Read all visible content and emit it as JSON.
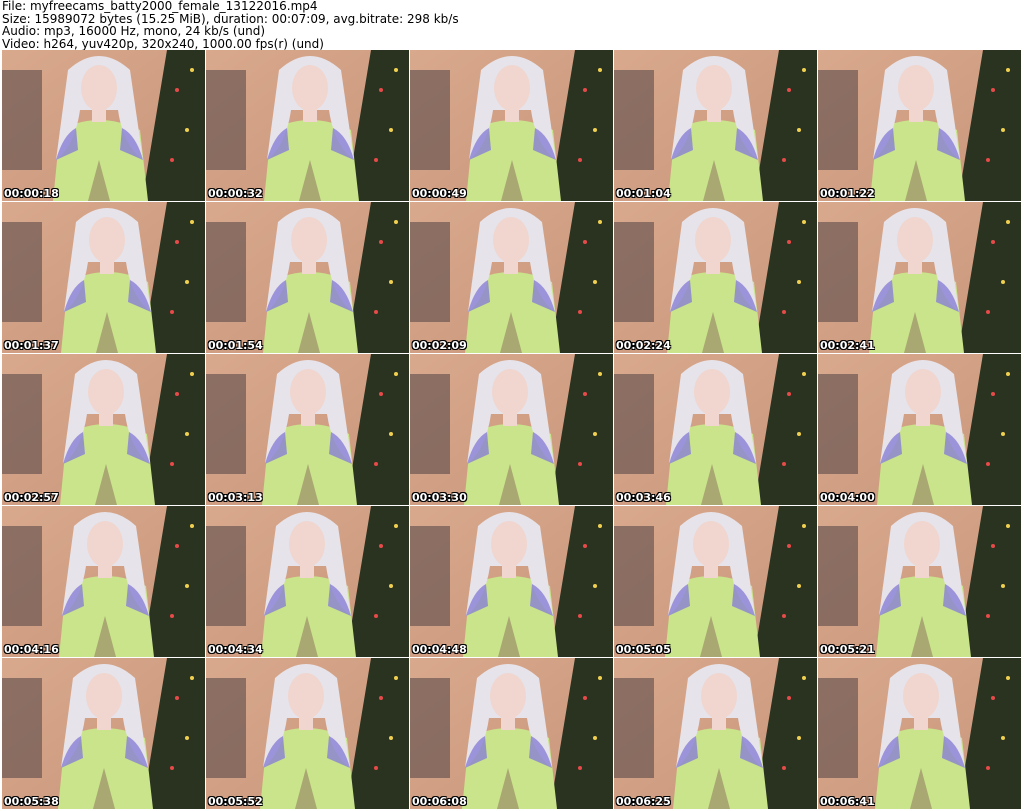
{
  "header": {
    "file_line": "File: myfreecams_batty2000_female_13122016.mp4",
    "size_line": "Size: 15989072 bytes (15.25 MiB), duration: 00:07:09, avg.bitrate: 298 kb/s",
    "audio_line": "Audio: mp3, 16000 Hz, mono, 24 kb/s (und)",
    "video_line": "Video: h264, yuv420p, 320x240, 1000.00 fps(r) (und)"
  },
  "thumbnails": [
    {
      "timestamp": "00:00:18"
    },
    {
      "timestamp": "00:00:32"
    },
    {
      "timestamp": "00:00:49"
    },
    {
      "timestamp": "00:01:04"
    },
    {
      "timestamp": "00:01:22"
    },
    {
      "timestamp": "00:01:37"
    },
    {
      "timestamp": "00:01:54"
    },
    {
      "timestamp": "00:02:09"
    },
    {
      "timestamp": "00:02:24"
    },
    {
      "timestamp": "00:02:41"
    },
    {
      "timestamp": "00:02:57"
    },
    {
      "timestamp": "00:03:13"
    },
    {
      "timestamp": "00:03:30"
    },
    {
      "timestamp": "00:03:46"
    },
    {
      "timestamp": "00:04:00"
    },
    {
      "timestamp": "00:04:16"
    },
    {
      "timestamp": "00:04:34"
    },
    {
      "timestamp": "00:04:48"
    },
    {
      "timestamp": "00:05:05"
    },
    {
      "timestamp": "00:05:21"
    },
    {
      "timestamp": "00:05:38"
    },
    {
      "timestamp": "00:05:52"
    },
    {
      "timestamp": "00:06:08"
    },
    {
      "timestamp": "00:06:25"
    },
    {
      "timestamp": "00:06:41"
    }
  ],
  "colors": {
    "wall": "#c8957a",
    "hair": "#e6e3ea",
    "hair_tips": "#8a7fd6",
    "top": "#c9e48a",
    "tree": "#2a3320",
    "skin": "#f0d6cf"
  }
}
